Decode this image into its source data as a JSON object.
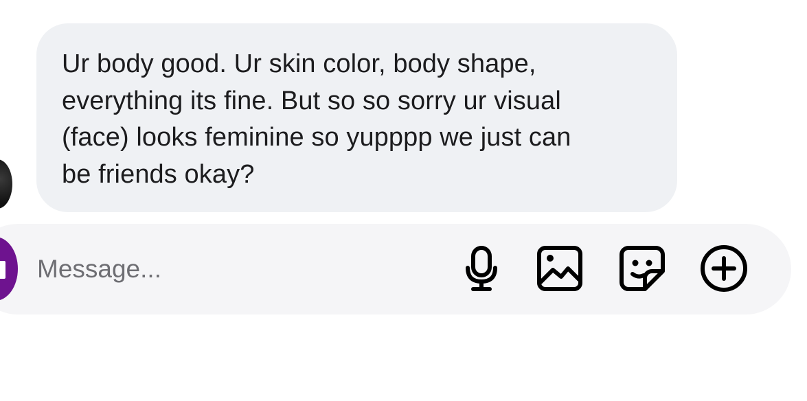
{
  "conversation": {
    "incoming_message": {
      "text": "Ur body good. Ur skin color, body shape,\neverything its fine. But so so sorry ur visual\n(face) looks feminine so yupppp we just can\nbe friends okay?"
    }
  },
  "composer": {
    "placeholder": "Message...",
    "icons": {
      "voice": "microphone-icon",
      "gallery": "image-icon",
      "sticker": "sticker-icon",
      "more": "plus-circle-icon"
    }
  },
  "colors": {
    "bubble_background": "#eff1f4",
    "composer_background": "#f5f5f7",
    "text": "#1c1c1e",
    "placeholder": "#6e6e73",
    "self_avatar": "#6e138f"
  }
}
